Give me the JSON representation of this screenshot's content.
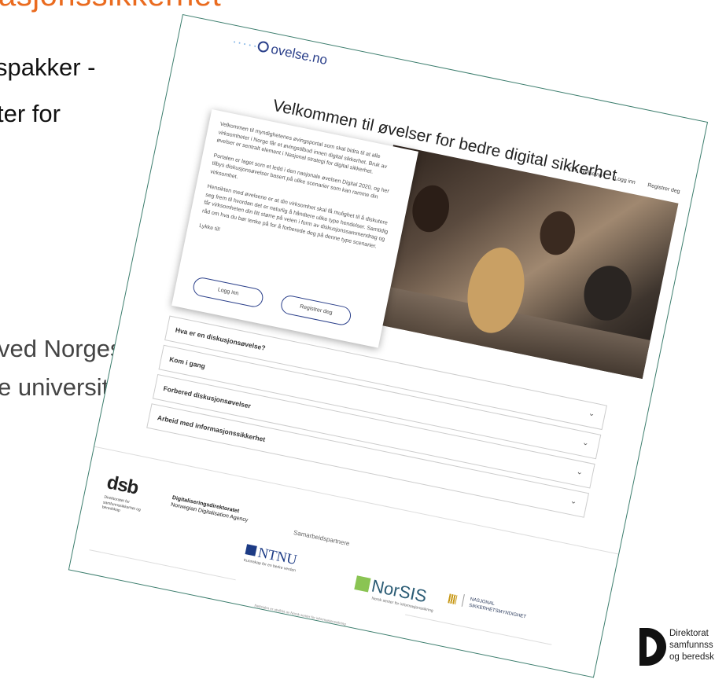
{
  "slide": {
    "title_fragment": "asjonssikkerhet",
    "line1": "spakker -",
    "line2": "ter for",
    "line3": "ved Norges",
    "line4": "e universitet",
    "corner_logo": {
      "line1": "Direktorat",
      "line2": "samfunnss",
      "line3": "og beredsk"
    }
  },
  "screenshot": {
    "logo_dots": "·····",
    "logo_text": "ovelse.no",
    "nav": {
      "about": "Om ovelse.no",
      "login": "Logg inn",
      "register": "Registrer deg"
    },
    "hero_title": "Velkommen til øvelser for bedre digital sikkerhet",
    "intro": {
      "p1": "Velkommen til myndighetenes øvingsportal som skal bidra til at alle virksomheter i Norge får et øvingstilbud innen digital sikkerhet. Bruk av øvelser er sentralt element i Nasjonal strategi for digital sikkerhet.",
      "p2": "Portalen er laget som et ledd i den nasjonale øvelsen Digital 2020, og her tilbys diskusjonsøvelser basert på ulike scenarier som kan ramme din virksomhet.",
      "p3": "Hensikten med øvelsene er at din virksomhet skal få mulighet til å diskutere seg frem til hvordan det er naturlig å håndtere ulike type hendelser. Samtidig får virksomheten din litt større på veien i form av diskusjonssammendrag og råd om hva du bør tenke på for å forberede deg på denne type scenarier.",
      "p4": "Lykke til!",
      "login_button": "Logg inn",
      "register_button": "Registrer deg"
    },
    "accordion": [
      {
        "label": "Hva er en diskusjonsøvelse?",
        "chevron": "⌄"
      },
      {
        "label": "Kom i gang",
        "chevron": "⌄"
      },
      {
        "label": "Forbered diskusjonsøvelser",
        "chevron": "⌄"
      },
      {
        "label": "Arbeid med informasjonssikkerhet",
        "chevron": "⌄"
      }
    ],
    "footer": {
      "dsb_mark": "dsb",
      "dsb_sub": "Direktoratet for samfunnssikkerhet og beredskap",
      "digdir_name": "Digitaliseringsdirektoratet",
      "digdir_en": "Norwegian Digitalisation Agency",
      "partners_heading": "Samarbeidspartnere",
      "ntnu": "NTNU",
      "ntnu_sub": "Kunnskap for en bedre verden",
      "norsis": "NorSIS",
      "norsis_sub": "Norsk senter for informasjonssikring",
      "nsm_line1": "NASJONAL",
      "nsm_line2": "SIKKERHETSMYNDIGHET",
      "note": "Nettsiden er utviklet av Norsk senter for informasjonssikring"
    }
  }
}
